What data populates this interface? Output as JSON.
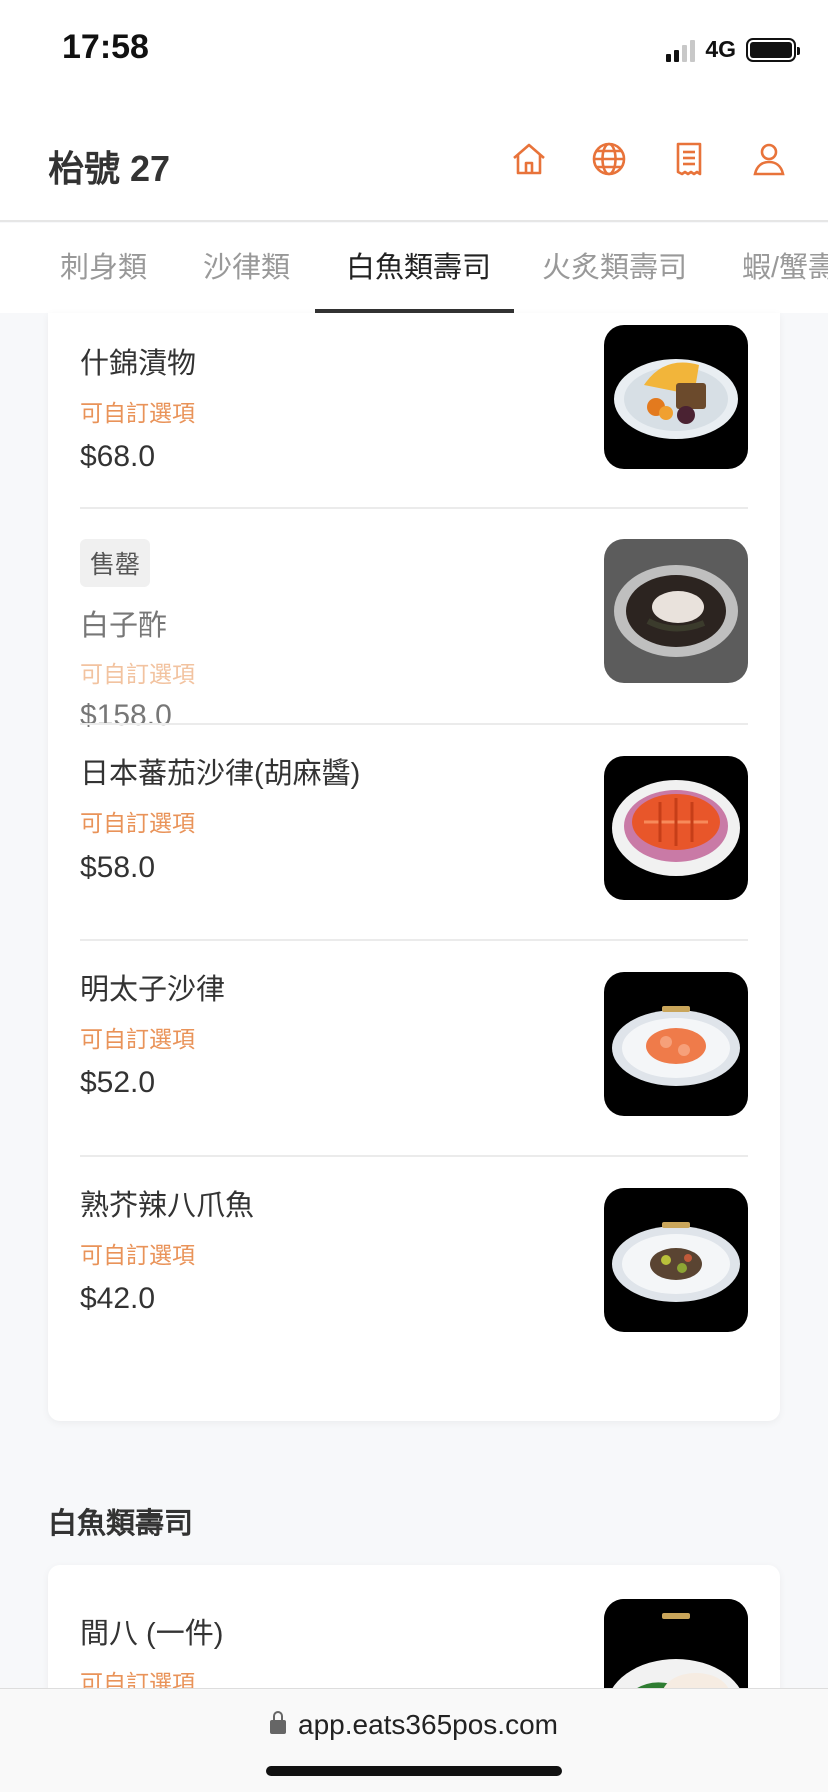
{
  "status_bar": {
    "time": "17:58",
    "network": "4G"
  },
  "header": {
    "title": "枱號 27",
    "icons": [
      "home-icon",
      "globe-icon",
      "receipt-icon",
      "user-icon"
    ],
    "accent_color": "#e8733a"
  },
  "tabs": [
    {
      "label": "刺身類",
      "active": false
    },
    {
      "label": "沙律類",
      "active": false
    },
    {
      "label": "白魚類壽司",
      "active": true
    },
    {
      "label": "火炙類壽司",
      "active": false
    },
    {
      "label": "蝦/蟹壽",
      "active": false
    }
  ],
  "menu_items": [
    {
      "name": "什錦漬物",
      "option": "可自訂選項",
      "price": "$68.0",
      "sold_out": false
    },
    {
      "sold_tag": "售罄",
      "name": "白子酢",
      "option": "可自訂選項",
      "price": "$158.0",
      "sold_out": true
    },
    {
      "name": "日本蕃茄沙律(胡麻醬)",
      "option": "可自訂選項",
      "price": "$58.0",
      "sold_out": false
    },
    {
      "name": "明太子沙律",
      "option": "可自訂選項",
      "price": "$52.0",
      "sold_out": false
    },
    {
      "name": "熟芥辣八爪魚",
      "option": "可自訂選項",
      "price": "$42.0",
      "sold_out": false
    }
  ],
  "section": {
    "title": "白魚類壽司",
    "items": [
      {
        "name": "間八 (一件)",
        "option": "可自訂選項"
      }
    ]
  },
  "url_bar": {
    "url": "app.eats365pos.com"
  }
}
